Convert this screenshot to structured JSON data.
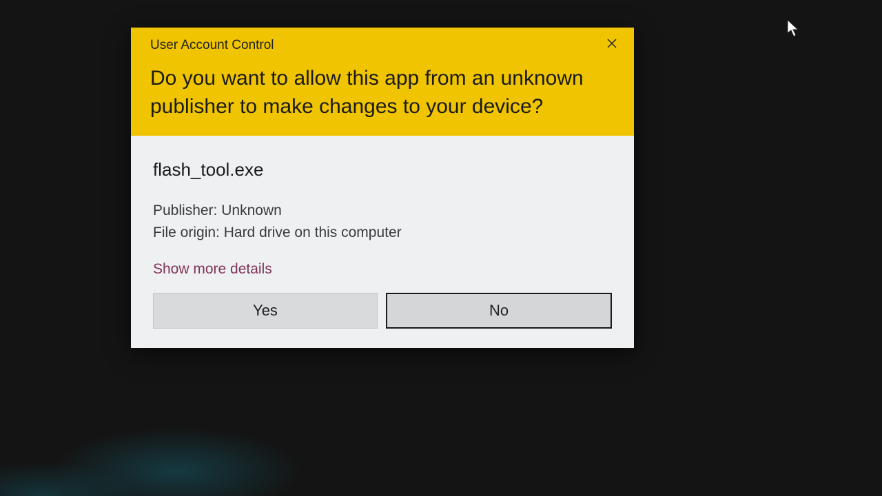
{
  "dialog": {
    "title": "User Account Control",
    "heading": "Do you want to allow this app from an unknown publisher to make changes to your device?",
    "app_name": "flash_tool.exe",
    "publisher_label": "Publisher:",
    "publisher_value": "Unknown",
    "origin_label": "File origin:",
    "origin_value": "Hard drive on this computer",
    "more_details": "Show more details",
    "yes_label": "Yes",
    "no_label": "No"
  },
  "colors": {
    "header_bg": "#f0c400",
    "body_bg": "#eef0f2",
    "link": "#7f335a"
  }
}
